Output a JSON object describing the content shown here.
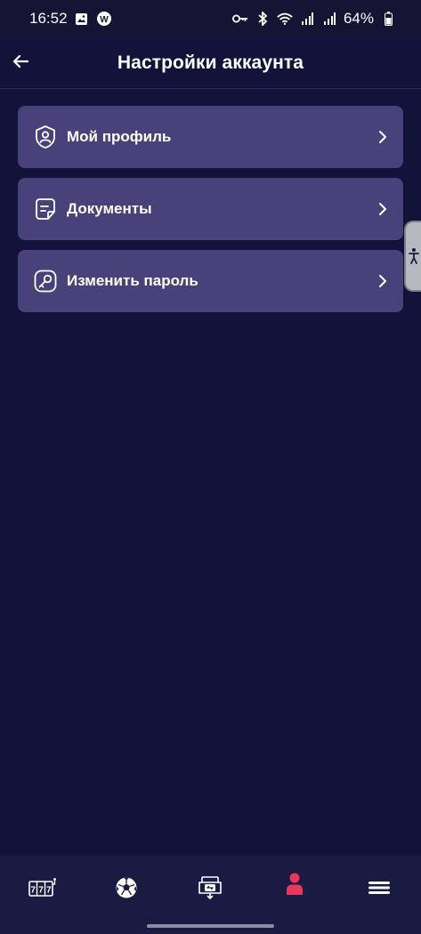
{
  "status_bar": {
    "time": "16:52",
    "battery": "64%",
    "left_icons": [
      "image-icon",
      "notification-badge-icon"
    ],
    "right_icons": [
      "key-icon",
      "bluetooth-icon",
      "wifi-icon",
      "signal-icon",
      "signal-icon",
      "battery-icon"
    ]
  },
  "header": {
    "title": "Настройки аккаунта",
    "back_icon": "arrow-left-icon"
  },
  "menu": {
    "items": [
      {
        "label": "Мой профиль",
        "icon": "profile-shield-icon"
      },
      {
        "label": "Документы",
        "icon": "document-icon"
      },
      {
        "label": "Изменить пароль",
        "icon": "key-icon"
      }
    ]
  },
  "accessibility_tab": {
    "icon": "accessibility-icon"
  },
  "bottom_nav": {
    "items": [
      {
        "icon": "slots-777-icon",
        "active": false
      },
      {
        "icon": "soccer-ball-icon",
        "active": false
      },
      {
        "icon": "transfer-icon",
        "active": false
      },
      {
        "icon": "user-icon",
        "active": true
      },
      {
        "icon": "hamburger-menu-icon",
        "active": false
      }
    ]
  },
  "colors": {
    "background": "#13123a",
    "card": "#49417a",
    "nav_background": "#1b1a43",
    "active_accent": "#e8365d"
  }
}
